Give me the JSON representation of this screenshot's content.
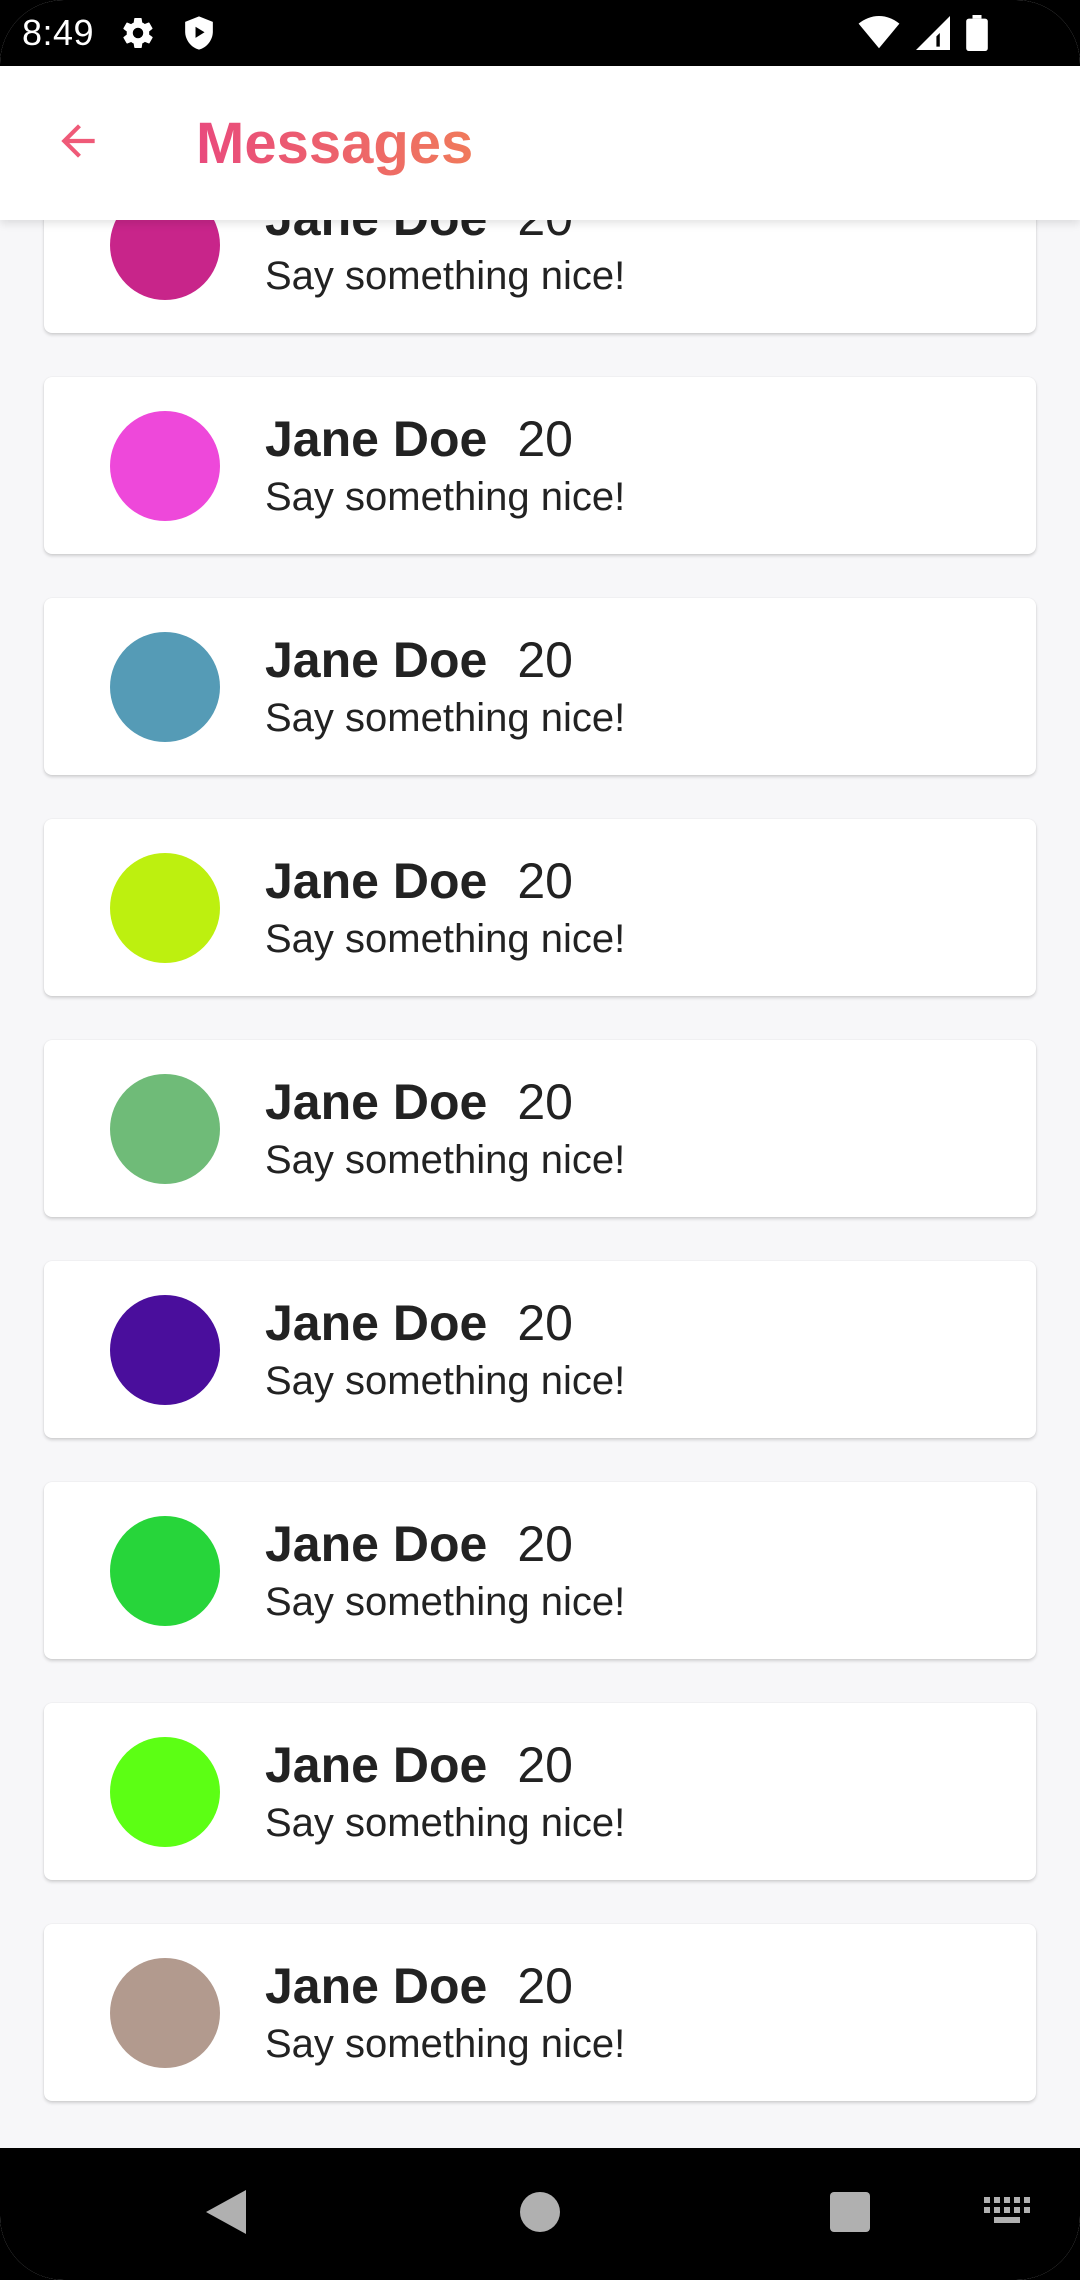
{
  "status_bar": {
    "time": "8:49",
    "left_icons": [
      "gear-icon",
      "shield-play-icon"
    ],
    "right_icons": [
      "wifi-icon",
      "cell-signal-icon",
      "battery-icon"
    ]
  },
  "app_bar": {
    "back_icon": "arrow-left-icon",
    "title": "Messages",
    "accent_start": "#e94a7d",
    "accent_end": "#f07a5b"
  },
  "messages": [
    {
      "name": "Jane Doe",
      "age": "20",
      "text": "Say something nice!",
      "color": "#c8258a"
    },
    {
      "name": "Jane Doe",
      "age": "20",
      "text": "Say something nice!",
      "color": "#ee48da"
    },
    {
      "name": "Jane Doe",
      "age": "20",
      "text": "Say something nice!",
      "color": "#559bb6"
    },
    {
      "name": "Jane Doe",
      "age": "20",
      "text": "Say something nice!",
      "color": "#bdf00f"
    },
    {
      "name": "Jane Doe",
      "age": "20",
      "text": "Say something nice!",
      "color": "#6fbb78"
    },
    {
      "name": "Jane Doe",
      "age": "20",
      "text": "Say something nice!",
      "color": "#4a0e9c"
    },
    {
      "name": "Jane Doe",
      "age": "20",
      "text": "Say something nice!",
      "color": "#27d53a"
    },
    {
      "name": "Jane Doe",
      "age": "20",
      "text": "Say something nice!",
      "color": "#5cff14"
    },
    {
      "name": "Jane Doe",
      "age": "20",
      "text": "Say something nice!",
      "color": "#b29a8e"
    }
  ],
  "nav_bar": {
    "icons": [
      "back-triangle-icon",
      "home-circle-icon",
      "recents-square-icon",
      "keyboard-icon"
    ]
  }
}
